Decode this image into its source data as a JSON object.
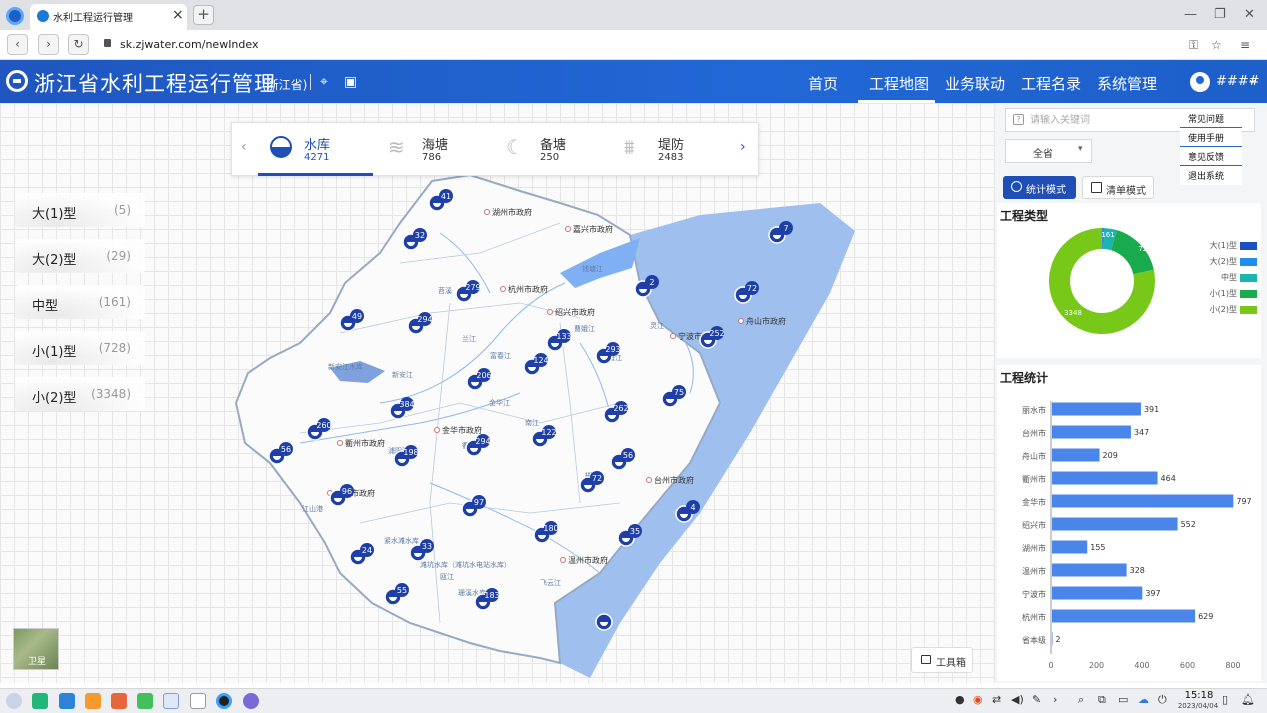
{
  "browser": {
    "tab_title": "水利工程运行管理",
    "new_tab_label": "+",
    "url": "sk.zjwater.com/newIndex"
  },
  "header": {
    "title": "浙江省水利工程运行管理",
    "region": "(浙江省)",
    "nav": [
      "首页",
      "工程地图",
      "业务联动",
      "工程名录",
      "系统管理"
    ],
    "active_nav": "工程地图",
    "user_name": "####"
  },
  "type_tabs": [
    {
      "name": "水库",
      "count": "4271",
      "icon": "reservoir-icon",
      "active": true
    },
    {
      "name": "海塘",
      "count": "786",
      "icon": "seawall-icon",
      "active": false
    },
    {
      "name": "备塘",
      "count": "250",
      "icon": "backup-seawall-icon",
      "active": false
    },
    {
      "name": "堤防",
      "count": "2483",
      "icon": "dike-icon",
      "active": false
    }
  ],
  "levels": [
    {
      "name": "大(1)型",
      "count": "(5)"
    },
    {
      "name": "大(2)型",
      "count": "(29)"
    },
    {
      "name": "中型",
      "count": "(161)"
    },
    {
      "name": "小(1)型",
      "count": "(728)"
    },
    {
      "name": "小(2)型",
      "count": "(3348)"
    }
  ],
  "map": {
    "city_labels": [
      "湖州市政府",
      "嘉兴市政府",
      "杭州市政府",
      "绍兴市政府",
      "舟山市政府",
      "宁波市政府",
      "金华市政府",
      "衢州市政府",
      "丽水市政府",
      "台州市政府",
      "温州市政府"
    ],
    "water_labels": [
      "新安江水库",
      "新安江",
      "钱塘江",
      "曹娥江",
      "苕溪",
      "富春江",
      "兰江",
      "金华江",
      "衢江",
      "瓯江",
      "飞云江",
      "江山港",
      "紧水滩水库",
      "滩坑水库（滩坑水电站水库）",
      "珊溪水库",
      "灵江",
      "浦阳江",
      "甬江",
      "椒江",
      "南江"
    ],
    "markers": [
      {
        "count": "41"
      },
      {
        "count": "32"
      },
      {
        "count": "279"
      },
      {
        "count": "2"
      },
      {
        "count": "7"
      },
      {
        "count": "72"
      },
      {
        "count": "49"
      },
      {
        "count": "294"
      },
      {
        "count": "133"
      },
      {
        "count": "293"
      },
      {
        "count": "252"
      },
      {
        "count": "124"
      },
      {
        "count": "206"
      },
      {
        "count": "75"
      },
      {
        "count": "384"
      },
      {
        "count": "262"
      },
      {
        "count": "260"
      },
      {
        "count": "294"
      },
      {
        "count": "122"
      },
      {
        "count": "56"
      },
      {
        "count": "198"
      },
      {
        "count": "56"
      },
      {
        "count": "72"
      },
      {
        "count": "96"
      },
      {
        "count": "97"
      },
      {
        "count": "4"
      },
      {
        "count": "180"
      },
      {
        "count": "35"
      },
      {
        "count": "24"
      },
      {
        "count": "33"
      },
      {
        "count": "55"
      },
      {
        "count": "183"
      },
      {
        "count": ""
      }
    ],
    "satellite_label": "卫星",
    "toolbox_label": "工具箱"
  },
  "right_panel": {
    "search_placeholder": "请输入关键词",
    "region_select": "全省",
    "user_menu": [
      "常见问题",
      "使用手册",
      "意见反馈",
      "退出系统"
    ],
    "mode_buttons": [
      "统计模式",
      "清单模式"
    ],
    "type_chart_title": "工程类型",
    "stats_chart_title": "工程统计"
  },
  "colors": {
    "brand": "#1f56bf",
    "accent": "#1f4fb6",
    "bar": "#4a86ea",
    "sea": "#9fc0ef"
  },
  "chart_data": [
    {
      "type": "pie",
      "title": "工程类型",
      "categories": [
        "大(1)型",
        "大(2)型",
        "中型",
        "小(1)型",
        "小(2)型"
      ],
      "values": [
        5,
        29,
        161,
        728,
        3348
      ],
      "colors": [
        "#1d4fc4",
        "#1f8ef0",
        "#1bb4b0",
        "#1aab4f",
        "#78c81a"
      ],
      "data_labels": [
        "161",
        "728",
        "3348"
      ],
      "donut": true,
      "legend": "right"
    },
    {
      "type": "bar",
      "orientation": "horizontal",
      "title": "工程统计",
      "categories": [
        "丽水市",
        "台州市",
        "舟山市",
        "衢州市",
        "金华市",
        "绍兴市",
        "湖州市",
        "温州市",
        "宁波市",
        "杭州市",
        "省本级"
      ],
      "values": [
        391,
        347,
        209,
        464,
        797,
        552,
        155,
        328,
        397,
        629,
        2
      ],
      "xlim": [
        0,
        800
      ],
      "xticks": [
        "0",
        "200",
        "400",
        "600",
        "800"
      ],
      "grid": false
    }
  ],
  "taskbar": {
    "time": "15:18",
    "date": "2023/04/04"
  }
}
